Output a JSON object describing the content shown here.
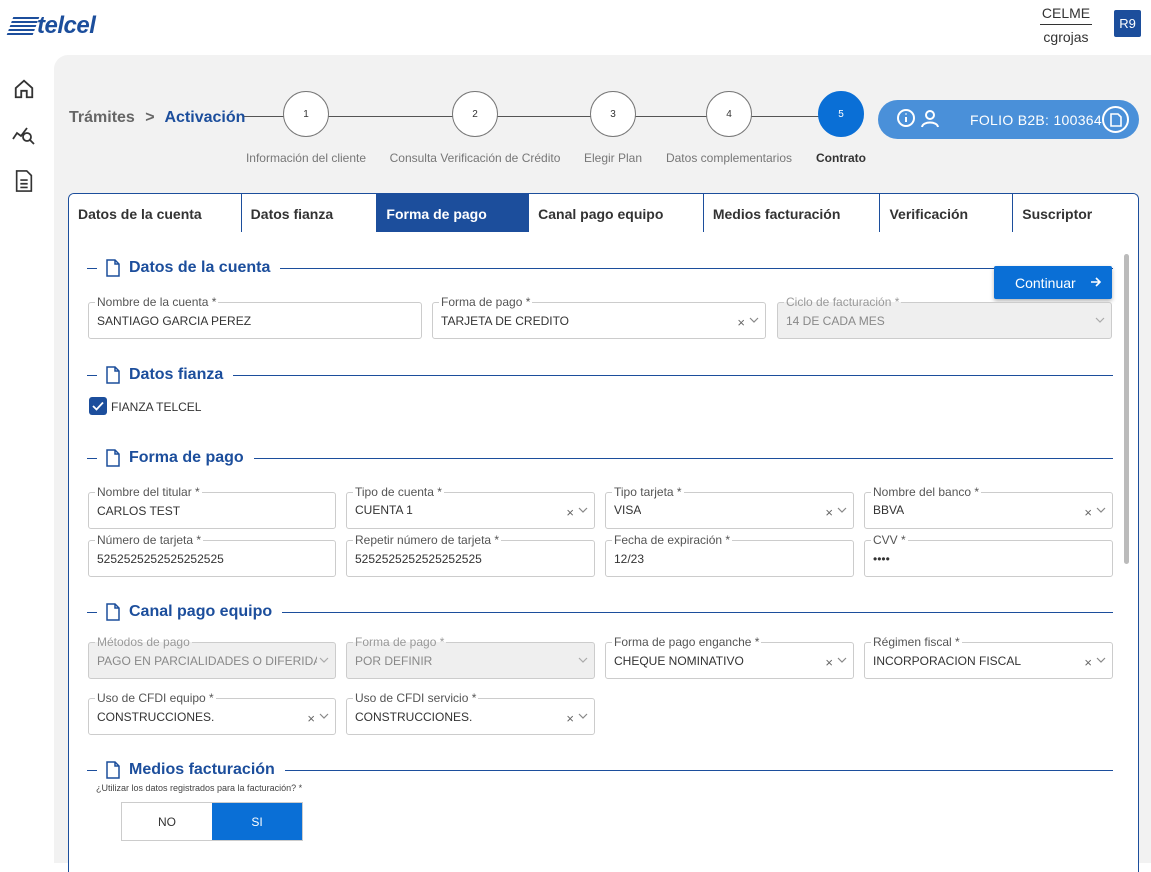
{
  "brand": {
    "name": "telcel"
  },
  "user": {
    "org": "CELME",
    "username": "cgrojas",
    "initials": "R9"
  },
  "breadcrumb": {
    "parent": "Trámites",
    "separator": ">",
    "current": "Activación"
  },
  "steps": [
    {
      "num": "1",
      "label": "Información del cliente"
    },
    {
      "num": "2",
      "label": "Consulta Verificación de Crédito"
    },
    {
      "num": "3",
      "label": "Elegir Plan"
    },
    {
      "num": "4",
      "label": "Datos complementarios"
    },
    {
      "num": "5",
      "label": "Contrato"
    }
  ],
  "folio": {
    "text": "FOLIO B2B: 100364"
  },
  "tabs": [
    "Datos de la cuenta",
    "Datos fianza",
    "Forma de pago",
    "Canal pago equipo",
    "Medios facturación",
    "Verificación",
    "Suscriptor"
  ],
  "active_tab": "Forma de pago",
  "continue_label": "Continuar",
  "sections": {
    "cuenta": {
      "title": "Datos de la cuenta",
      "fields": [
        {
          "label": "Nombre de la cuenta *",
          "value": "SANTIAGO GARCIA PEREZ"
        },
        {
          "label": "Forma de pago *",
          "value": "TARJETA DE CREDITO"
        },
        {
          "label": "Ciclo de facturación *",
          "value": "14 DE CADA MES"
        }
      ]
    },
    "fianza": {
      "title": "Datos fianza",
      "checkbox_label": "FIANZA TELCEL"
    },
    "pago": {
      "title": "Forma de pago",
      "fields": [
        {
          "label": "Nombre del titular *",
          "value": "CARLOS TEST"
        },
        {
          "label": "Tipo de cuenta *",
          "value": "CUENTA 1"
        },
        {
          "label": "Tipo tarjeta *",
          "value": "VISA"
        },
        {
          "label": "Nombre del banco *",
          "value": "BBVA"
        },
        {
          "label": "Número de tarjeta *",
          "value": "5252525252525252525"
        },
        {
          "label": "Repetir número de tarjeta *",
          "value": "5252525252525252525"
        },
        {
          "label": "Fecha de expiración *",
          "value": "12/23"
        },
        {
          "label": "CVV *",
          "value": "••••"
        }
      ]
    },
    "canal": {
      "title": "Canal pago equipo",
      "fields": [
        {
          "label": "Métodos de pago",
          "value": "PAGO EN PARCIALIDADES O DIFERIDA"
        },
        {
          "label": "Forma de pago *",
          "value": "POR DEFINIR"
        },
        {
          "label": "Forma de pago enganche *",
          "value": "CHEQUE NOMINATIVO"
        },
        {
          "label": "Régimen fiscal *",
          "value": "INCORPORACION FISCAL"
        },
        {
          "label": "Uso de CFDI equipo *",
          "value": "CONSTRUCCIONES."
        },
        {
          "label": "Uso de CFDI servicio *",
          "value": "CONSTRUCCIONES."
        }
      ]
    },
    "medios": {
      "title": "Medios facturación",
      "question": "¿Utilizar los datos registrados para la facturación? *",
      "options": [
        "NO",
        "SI"
      ],
      "selected": "SI"
    }
  },
  "colors": {
    "brand": "#1c4e9c",
    "accent": "#0a6fd6",
    "folio_bg": "#4a90d9"
  },
  "icons": [
    "home-icon",
    "analytics-search-icon",
    "document-icon",
    "info-icon",
    "user-icon",
    "file-icon",
    "check-icon",
    "clear-icon",
    "chevron-down-icon",
    "arrow-right-icon"
  ]
}
